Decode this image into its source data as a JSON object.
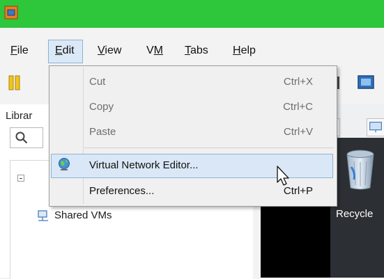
{
  "window": {
    "title": ""
  },
  "menubar": {
    "items": [
      {
        "label": "File",
        "underline": "F",
        "rest": "ile"
      },
      {
        "label": "Edit",
        "underline": "E",
        "rest": "dit"
      },
      {
        "label": "View",
        "underline": "V",
        "rest": "iew"
      },
      {
        "label": "VM",
        "underline": "M",
        "prefix": "V"
      },
      {
        "label": "Tabs",
        "underline": "T",
        "rest": "abs"
      },
      {
        "label": "Help",
        "underline": "H",
        "rest": "elp"
      }
    ]
  },
  "edit_menu": {
    "items": [
      {
        "label": "Cut",
        "shortcut": "Ctrl+X",
        "enabled": false
      },
      {
        "label": "Copy",
        "shortcut": "Ctrl+C",
        "enabled": false
      },
      {
        "label": "Paste",
        "shortcut": "Ctrl+V",
        "enabled": false
      },
      {
        "label": "Virtual Network Editor...",
        "shortcut": "",
        "enabled": true,
        "icon": "globe-icon",
        "highlighted": true
      },
      {
        "label": "Preferences...",
        "shortcut": "Ctrl+P",
        "enabled": true
      }
    ]
  },
  "library": {
    "title": "Librar",
    "tree": [
      {
        "label": "Shared VMs",
        "icon": "shared-vms-icon"
      }
    ]
  },
  "vm_desktop": {
    "recycle_label": "Recycle"
  },
  "colors": {
    "titlebar": "#2ec63a",
    "highlight": "#d9e7f6",
    "highlight_border": "#8fb3d9"
  }
}
